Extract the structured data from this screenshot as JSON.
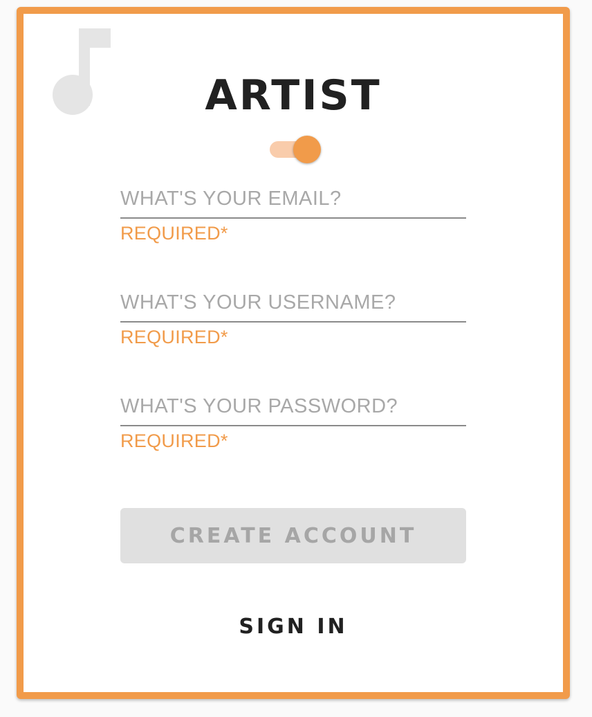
{
  "header": {
    "title": "ARTIST",
    "icon": "music-note-icon"
  },
  "role_toggle": {
    "checked": true
  },
  "form": {
    "email": {
      "placeholder": "WHAT'S YOUR EMAIL?",
      "value": "",
      "hint": "REQUIRED*"
    },
    "username": {
      "placeholder": "WHAT'S YOUR USERNAME?",
      "value": "",
      "hint": "REQUIRED*"
    },
    "password": {
      "placeholder": "WHAT'S YOUR PASSWORD?",
      "value": "",
      "hint": "REQUIRED*"
    }
  },
  "actions": {
    "create_label": "CREATE ACCOUNT",
    "signin_label": "SIGN IN"
  },
  "colors": {
    "accent": "#f19b4a",
    "accent_light": "#f9ccab",
    "button_disabled_bg": "#e0e0e0",
    "button_disabled_text": "#a6a6a6",
    "title_text": "#212121",
    "placeholder_text": "#a8a8a8"
  }
}
